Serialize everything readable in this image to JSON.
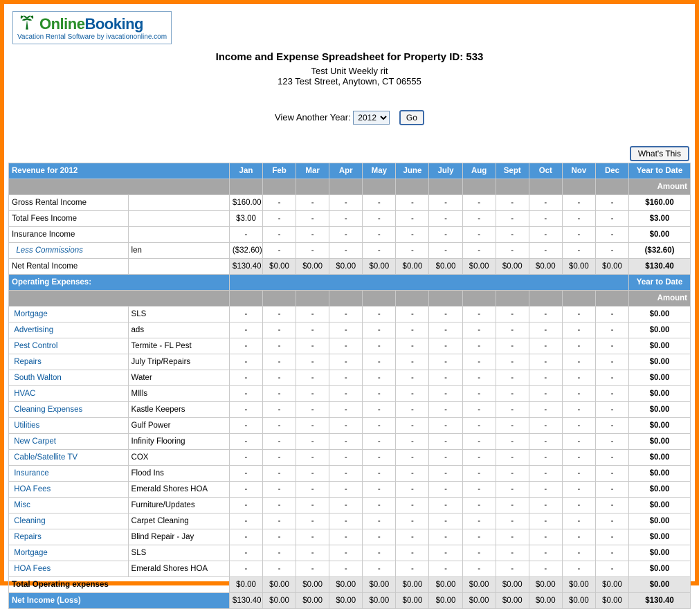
{
  "logo": {
    "textOnline": "Online",
    "textBooking": "Booking",
    "subtitle": "Vacation Rental Software by ivacationonline.com"
  },
  "header": {
    "title": "Income and Expense Spreadsheet for Property ID: 533",
    "propertyName": "Test Unit Weekly rit",
    "address": "123 Test Street, Anytown, CT 06555"
  },
  "yearSelector": {
    "label": "View Another Year:",
    "selected": "2012",
    "goLabel": "Go"
  },
  "whatsThis": "What's This",
  "months": [
    "Jan",
    "Feb",
    "Mar",
    "Apr",
    "May",
    "June",
    "July",
    "Aug",
    "Sept",
    "Oct",
    "Nov",
    "Dec"
  ],
  "revenue": {
    "header": "Revenue for 2012",
    "ytdHeader": "Year to Date",
    "amountHeader": "Amount",
    "rows": [
      {
        "label": "Gross Rental Income",
        "type": "plain",
        "values": [
          "$160.00",
          "-",
          "-",
          "-",
          "-",
          "-",
          "-",
          "-",
          "-",
          "-",
          "-",
          "-"
        ],
        "ytd": "$160.00"
      },
      {
        "label": "Total Fees Income",
        "type": "plain",
        "values": [
          "$3.00",
          "-",
          "-",
          "-",
          "-",
          "-",
          "-",
          "-",
          "-",
          "-",
          "-",
          "-"
        ],
        "ytd": "$3.00"
      },
      {
        "label": "Insurance Income",
        "type": "plain",
        "values": [
          "-",
          "-",
          "-",
          "-",
          "-",
          "-",
          "-",
          "-",
          "-",
          "-",
          "-",
          "-"
        ],
        "ytd": "$0.00"
      },
      {
        "label": "Less Commissions",
        "type": "italic",
        "vendor": "len",
        "values": [
          "($32.60)",
          "-",
          "-",
          "-",
          "-",
          "-",
          "-",
          "-",
          "-",
          "-",
          "-",
          "-"
        ],
        "ytd": "($32.60)"
      }
    ],
    "net": {
      "label": "Net Rental Income",
      "values": [
        "$130.40",
        "$0.00",
        "$0.00",
        "$0.00",
        "$0.00",
        "$0.00",
        "$0.00",
        "$0.00",
        "$0.00",
        "$0.00",
        "$0.00",
        "$0.00"
      ],
      "ytd": "$130.40"
    }
  },
  "expenses": {
    "header": "Operating Expenses:",
    "ytdHeader": "Year to Date",
    "amountHeader": "Amount",
    "rows": [
      {
        "label": "Mortgage",
        "vendor": "SLS",
        "values": [
          "-",
          "-",
          "-",
          "-",
          "-",
          "-",
          "-",
          "-",
          "-",
          "-",
          "-",
          "-"
        ],
        "ytd": "$0.00"
      },
      {
        "label": "Advertising",
        "vendor": "ads",
        "values": [
          "-",
          "-",
          "-",
          "-",
          "-",
          "-",
          "-",
          "-",
          "-",
          "-",
          "-",
          "-"
        ],
        "ytd": "$0.00"
      },
      {
        "label": "Pest Control",
        "vendor": "Termite - FL Pest",
        "values": [
          "-",
          "-",
          "-",
          "-",
          "-",
          "-",
          "-",
          "-",
          "-",
          "-",
          "-",
          "-"
        ],
        "ytd": "$0.00"
      },
      {
        "label": "Repairs",
        "vendor": "July Trip/Repairs",
        "values": [
          "-",
          "-",
          "-",
          "-",
          "-",
          "-",
          "-",
          "-",
          "-",
          "-",
          "-",
          "-"
        ],
        "ytd": "$0.00"
      },
      {
        "label": "South Walton",
        "vendor": "Water",
        "values": [
          "-",
          "-",
          "-",
          "-",
          "-",
          "-",
          "-",
          "-",
          "-",
          "-",
          "-",
          "-"
        ],
        "ytd": "$0.00"
      },
      {
        "label": "HVAC",
        "vendor": "MIlls",
        "values": [
          "-",
          "-",
          "-",
          "-",
          "-",
          "-",
          "-",
          "-",
          "-",
          "-",
          "-",
          "-"
        ],
        "ytd": "$0.00"
      },
      {
        "label": "Cleaning Expenses",
        "vendor": "Kastle Keepers",
        "values": [
          "-",
          "-",
          "-",
          "-",
          "-",
          "-",
          "-",
          "-",
          "-",
          "-",
          "-",
          "-"
        ],
        "ytd": "$0.00"
      },
      {
        "label": "Utilities",
        "vendor": "Gulf Power",
        "values": [
          "-",
          "-",
          "-",
          "-",
          "-",
          "-",
          "-",
          "-",
          "-",
          "-",
          "-",
          "-"
        ],
        "ytd": "$0.00"
      },
      {
        "label": "New Carpet",
        "vendor": "Infinity Flooring",
        "values": [
          "-",
          "-",
          "-",
          "-",
          "-",
          "-",
          "-",
          "-",
          "-",
          "-",
          "-",
          "-"
        ],
        "ytd": "$0.00"
      },
      {
        "label": "Cable/Satellite TV",
        "vendor": "COX",
        "values": [
          "-",
          "-",
          "-",
          "-",
          "-",
          "-",
          "-",
          "-",
          "-",
          "-",
          "-",
          "-"
        ],
        "ytd": "$0.00"
      },
      {
        "label": "Insurance",
        "vendor": "Flood Ins",
        "values": [
          "-",
          "-",
          "-",
          "-",
          "-",
          "-",
          "-",
          "-",
          "-",
          "-",
          "-",
          "-"
        ],
        "ytd": "$0.00"
      },
      {
        "label": "HOA Fees",
        "vendor": "Emerald Shores HOA",
        "values": [
          "-",
          "-",
          "-",
          "-",
          "-",
          "-",
          "-",
          "-",
          "-",
          "-",
          "-",
          "-"
        ],
        "ytd": "$0.00"
      },
      {
        "label": "Misc",
        "vendor": "Furniture/Updates",
        "values": [
          "-",
          "-",
          "-",
          "-",
          "-",
          "-",
          "-",
          "-",
          "-",
          "-",
          "-",
          "-"
        ],
        "ytd": "$0.00"
      },
      {
        "label": "Cleaning",
        "vendor": "Carpet Cleaning",
        "values": [
          "-",
          "-",
          "-",
          "-",
          "-",
          "-",
          "-",
          "-",
          "-",
          "-",
          "-",
          "-"
        ],
        "ytd": "$0.00"
      },
      {
        "label": "Repairs",
        "vendor": "Blind Repair - Jay",
        "values": [
          "-",
          "-",
          "-",
          "-",
          "-",
          "-",
          "-",
          "-",
          "-",
          "-",
          "-",
          "-"
        ],
        "ytd": "$0.00"
      },
      {
        "label": "Mortgage",
        "vendor": "SLS",
        "values": [
          "-",
          "-",
          "-",
          "-",
          "-",
          "-",
          "-",
          "-",
          "-",
          "-",
          "-",
          "-"
        ],
        "ytd": "$0.00"
      },
      {
        "label": "HOA Fees",
        "vendor": "Emerald Shores HOA",
        "values": [
          "-",
          "-",
          "-",
          "-",
          "-",
          "-",
          "-",
          "-",
          "-",
          "-",
          "-",
          "-"
        ],
        "ytd": "$0.00"
      }
    ],
    "total": {
      "label": "Total Operating expenses",
      "values": [
        "$0.00",
        "$0.00",
        "$0.00",
        "$0.00",
        "$0.00",
        "$0.00",
        "$0.00",
        "$0.00",
        "$0.00",
        "$0.00",
        "$0.00",
        "$0.00"
      ],
      "ytd": "$0.00"
    }
  },
  "netIncome": {
    "label": "Net Income (Loss)",
    "values": [
      "$130.40",
      "$0.00",
      "$0.00",
      "$0.00",
      "$0.00",
      "$0.00",
      "$0.00",
      "$0.00",
      "$0.00",
      "$0.00",
      "$0.00",
      "$0.00"
    ],
    "ytd": "$130.40"
  }
}
